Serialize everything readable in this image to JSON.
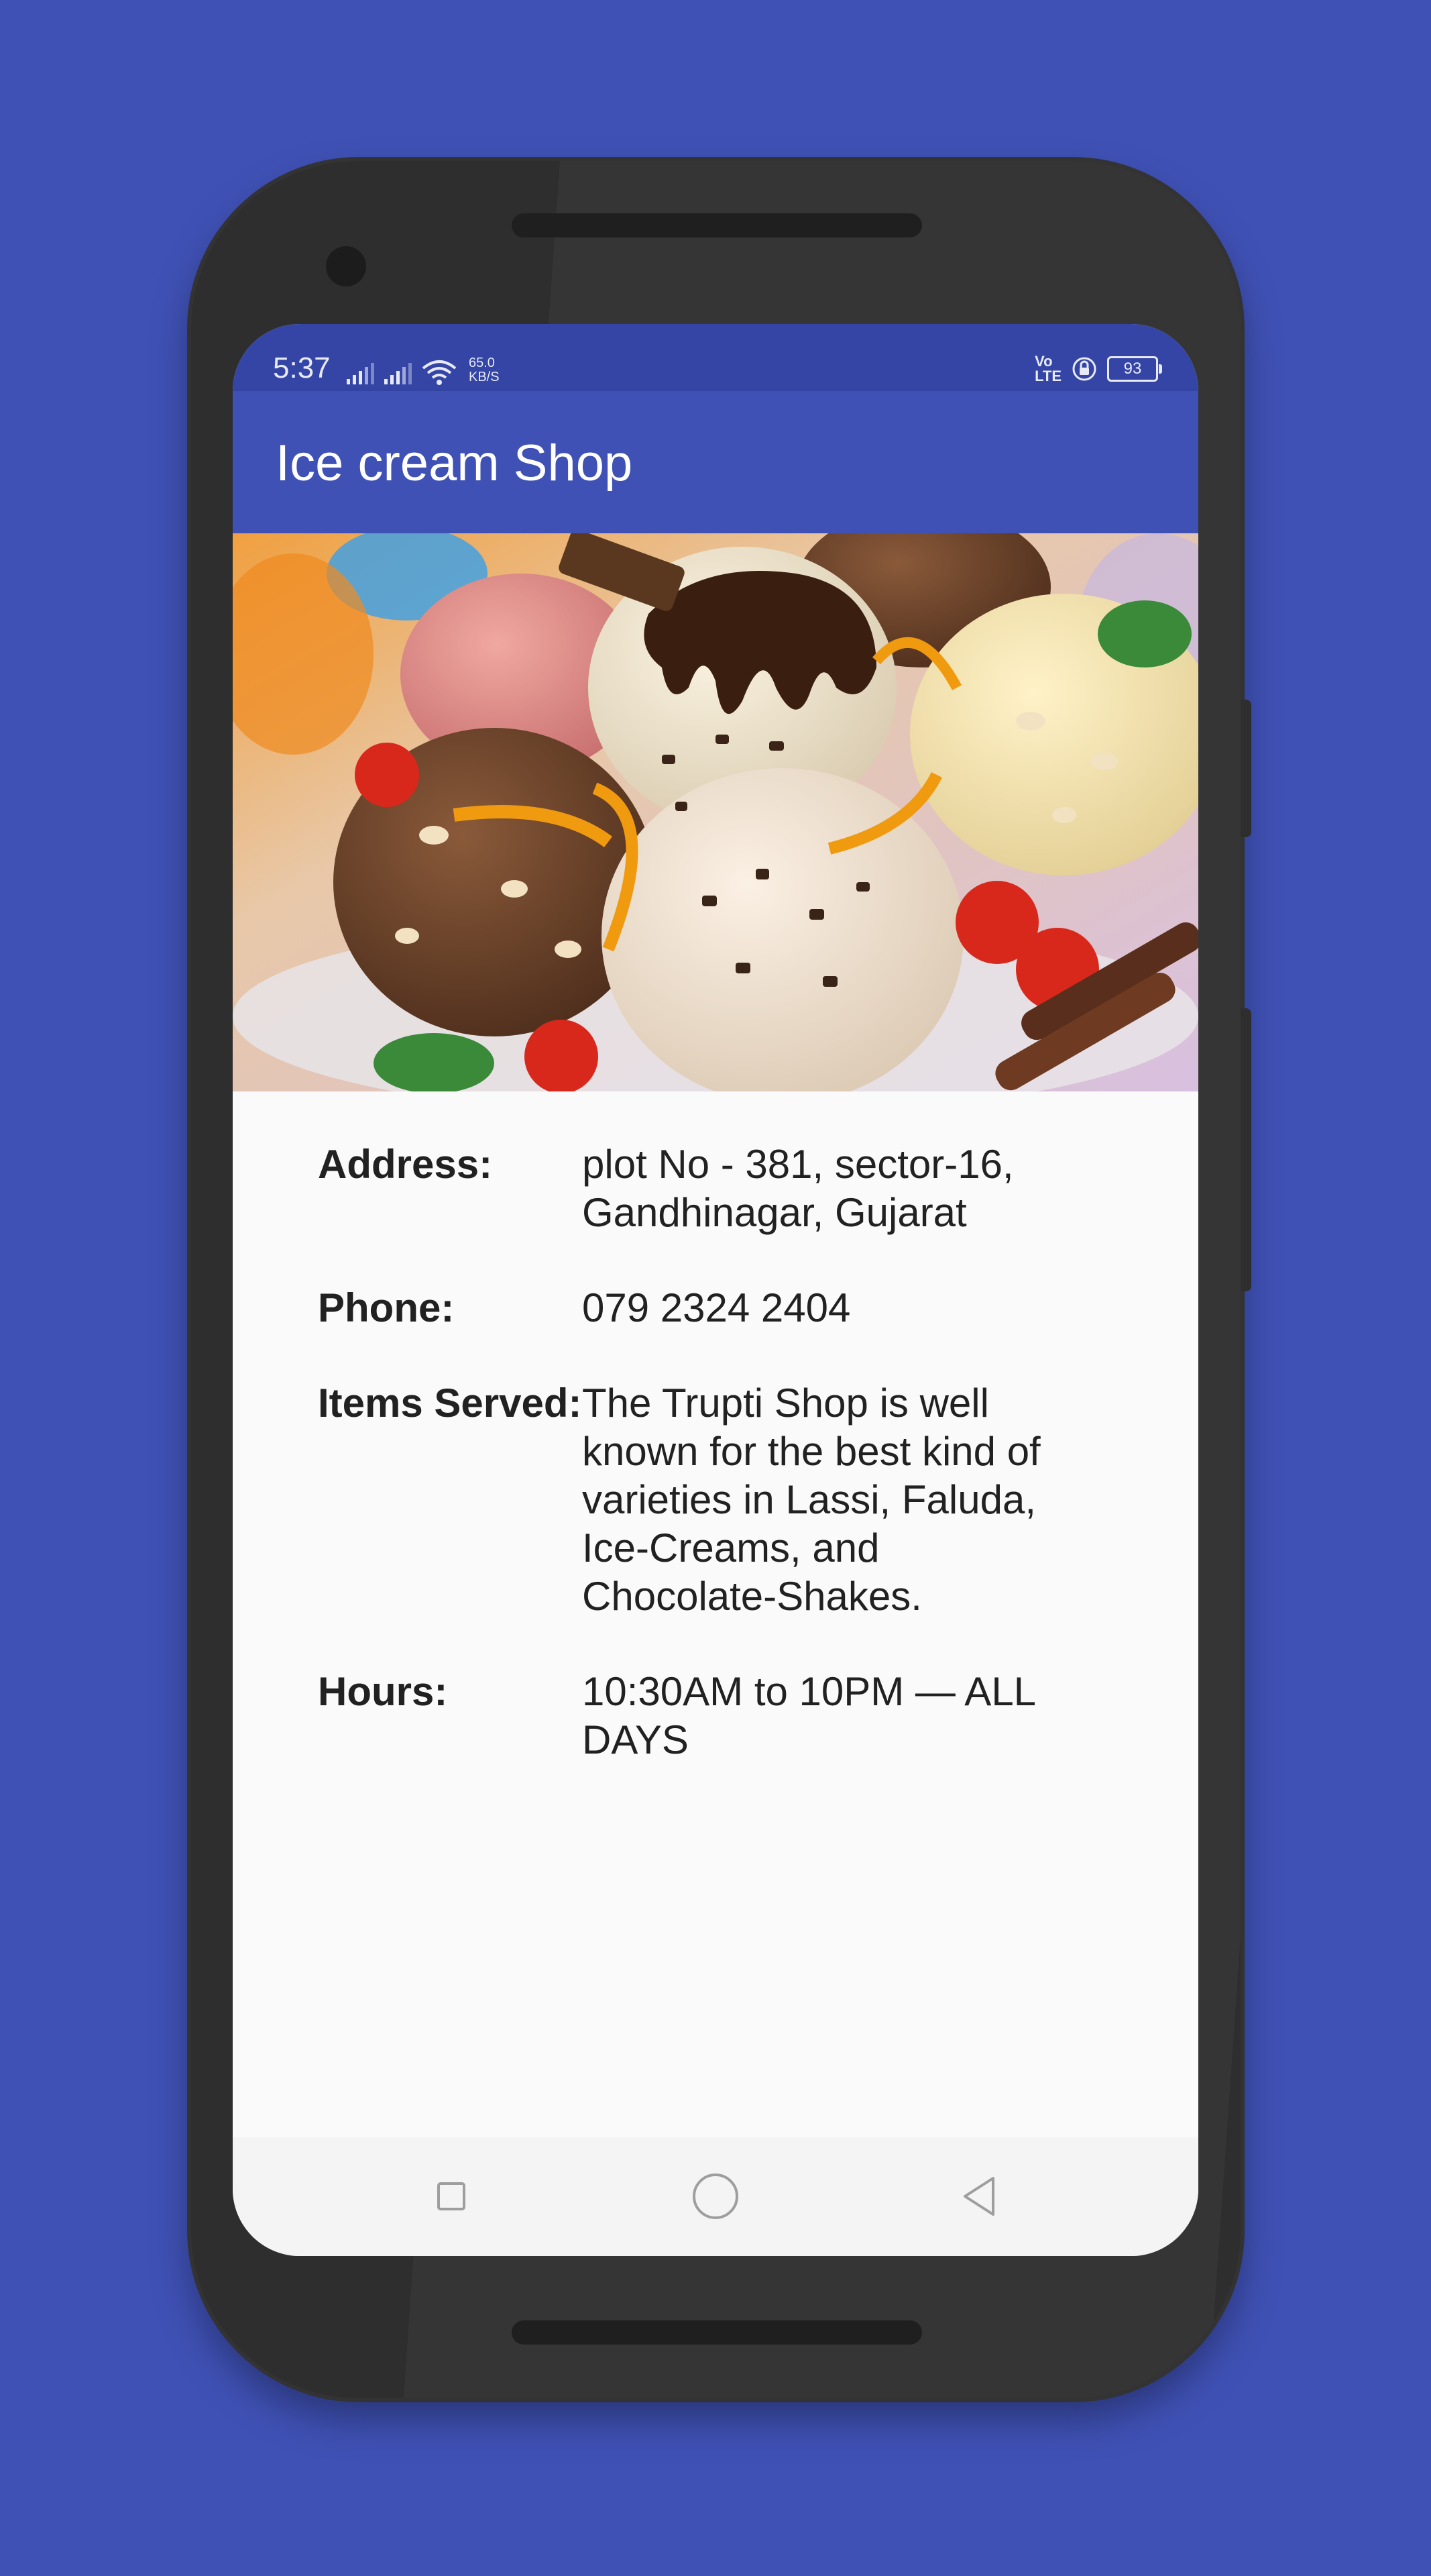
{
  "status_bar": {
    "time": "5:37",
    "speed_value": "65.0",
    "speed_unit": "KB/S",
    "volte_top": "Vo",
    "volte_bottom": "LTE",
    "battery": "93"
  },
  "app_bar": {
    "title": "Ice cream Shop"
  },
  "hero_image": {
    "description_icon": "ice-cream-scoops-photo"
  },
  "details": [
    {
      "label": "Address:",
      "value": "plot No - 381, sector-16, Gandhinagar, Gujarat"
    },
    {
      "label": "Phone:",
      "value": "079 2324 2404"
    },
    {
      "label": "Items Served:",
      "value": "The Trupti Shop is well known for the best kind of varieties in Lassi, Faluda, Ice-Creams, and Chocolate-Shakes."
    },
    {
      "label": "Hours:",
      "value": "10:30AM to 10PM — ALL DAYS"
    }
  ],
  "nav_bar": {
    "icons": [
      "square-recents-icon",
      "circle-home-icon",
      "triangle-back-icon"
    ]
  },
  "colors": {
    "background": "#3f51b5",
    "app_bar": "#3f51b5",
    "status_bar": "#3445a6",
    "screen": "#fafafa",
    "text": "#212121"
  }
}
